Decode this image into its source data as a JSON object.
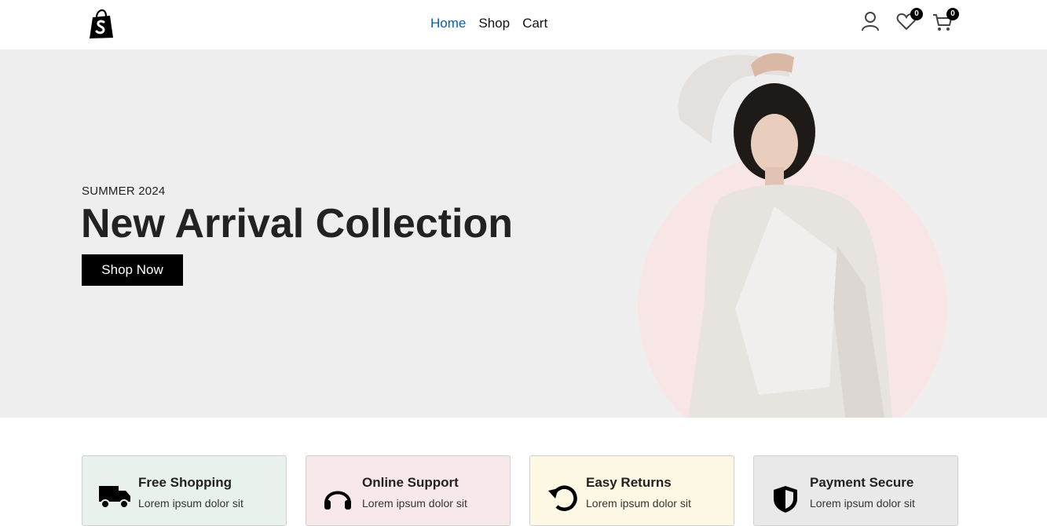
{
  "header": {
    "logo": "shopify-bag-logo",
    "nav": [
      {
        "label": "Home",
        "active": true
      },
      {
        "label": "Shop",
        "active": false
      },
      {
        "label": "Cart",
        "active": false
      }
    ],
    "wishlist_count": "0",
    "cart_count": "0"
  },
  "hero": {
    "subtitle": "SUMMER 2024",
    "title": "New Arrival Collection",
    "button": "Shop Now",
    "image": "woman-in-white-outfit"
  },
  "features": [
    {
      "title": "Free Shopping",
      "desc": "Lorem ipsum dolor sit",
      "icon": "truck-icon",
      "bg": "#e8f1ec"
    },
    {
      "title": "Online Support",
      "desc": "Lorem ipsum dolor sit",
      "icon": "headset-icon",
      "bg": "#f8e8e9"
    },
    {
      "title": "Easy Returns",
      "desc": "Lorem ipsum dolor sit",
      "icon": "return-icon",
      "bg": "#fdf8e4"
    },
    {
      "title": "Payment Secure",
      "desc": "Lorem ipsum dolor sit",
      "icon": "shield-icon",
      "bg": "#e9e9e9"
    }
  ],
  "colors": {
    "accent": "#0b5cad",
    "hero_bg": "#eeeeee",
    "circle": "#f8e6e6"
  }
}
